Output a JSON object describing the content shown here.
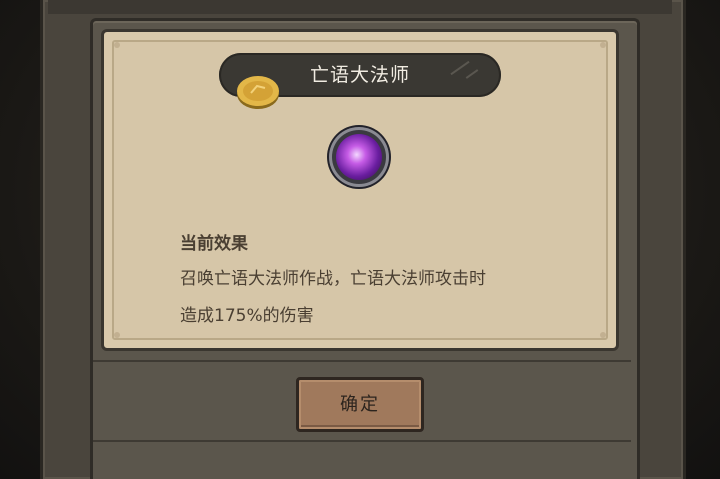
{
  "dialog": {
    "title": "亡语大法师",
    "effect_heading": "当前效果",
    "effect_line_1": "召唤亡语大法师作战，亡语大法师攻击时",
    "effect_line_2": "造成175%的伤害",
    "confirm_label": "确定"
  },
  "icons": {
    "coin": "gold-coin-icon",
    "skill": "purple-magic-orb-icon"
  },
  "colors": {
    "parchment": "#d9c9ab",
    "title_bar": "#3a3833",
    "title_text": "#f1ece2",
    "body_text": "#4a3f32",
    "button": "#a0795c",
    "skill_glow": "#c65ce6"
  }
}
